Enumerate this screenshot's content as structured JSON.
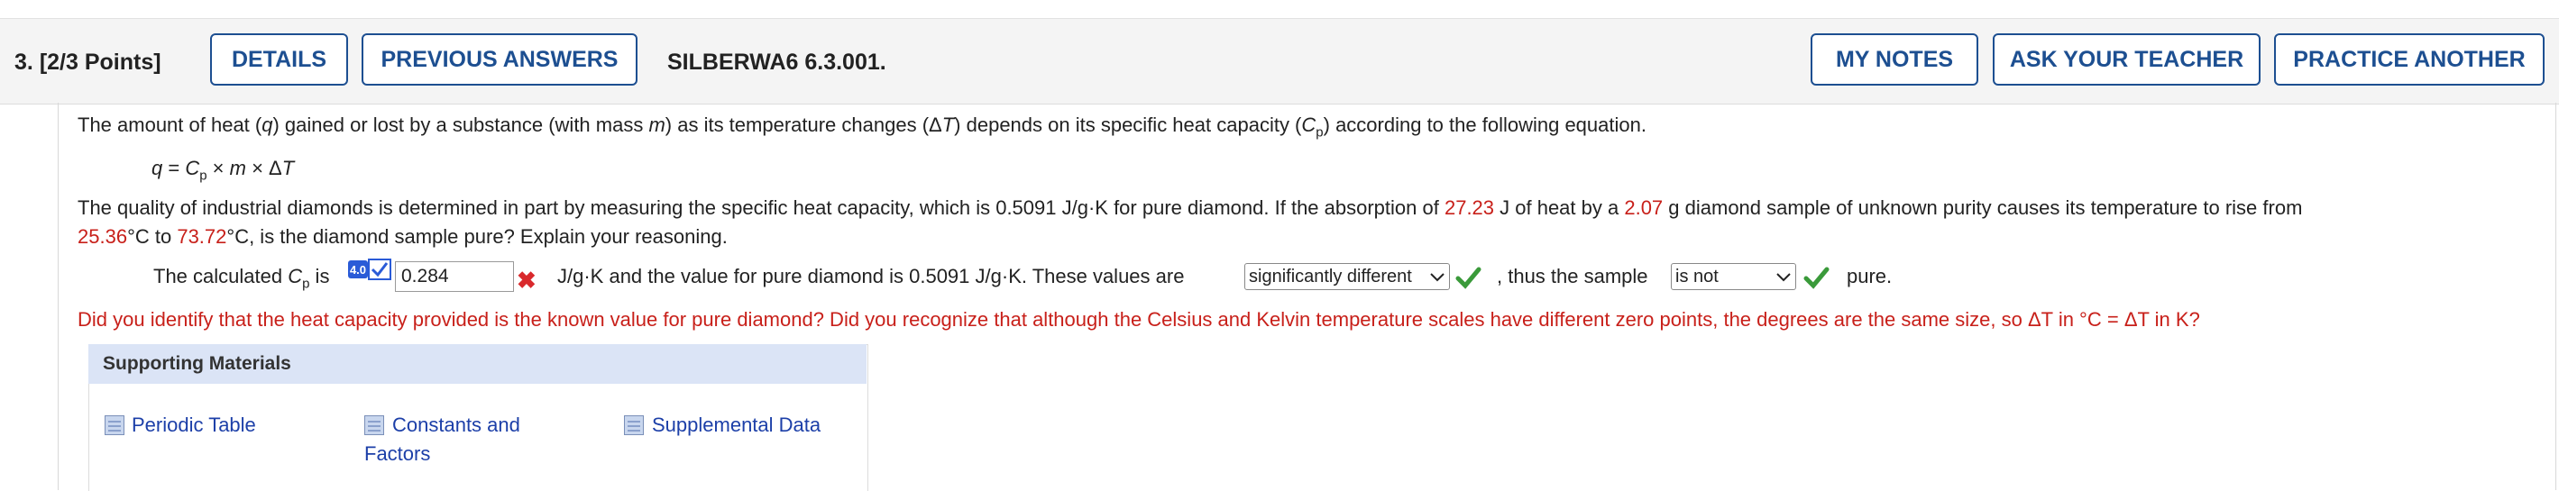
{
  "header": {
    "question_number": "3.",
    "points": "[2/3 Points]",
    "details_label": "DETAILS",
    "previous_answers_label": "PREVIOUS ANSWERS",
    "assignment_code": "SILBERWA6 6.3.001.",
    "my_notes_label": "MY NOTES",
    "ask_teacher_label": "ASK YOUR TEACHER",
    "practice_another_label": "PRACTICE ANOTHER"
  },
  "question": {
    "intro_a": "The amount of heat (",
    "q": "q",
    "intro_b": ") gained or lost by a substance (with mass ",
    "m": "m",
    "intro_c": ") as its temperature changes (Δ",
    "T": "T",
    "intro_d": ") depends on its specific heat capacity (",
    "C": "C",
    "p": "p",
    "intro_e": ") according to the following equation.",
    "eq_q": "q",
    "eq_eq": " = ",
    "eq_C": "C",
    "eq_p": "p",
    "eq_x1": " × ",
    "eq_m": "m",
    "eq_x2": " × Δ",
    "eq_T": "T",
    "body_a": "The quality of industrial diamonds is determined in part by measuring the specific heat capacity, which is 0.5091 J/g·K for pure diamond. If the absorption of ",
    "heat_value": "27.23",
    "body_b": " J of heat by a ",
    "mass_value": "2.07",
    "body_c": " g diamond sample of unknown purity causes its temperature to rise from",
    "temp_start": "25.36",
    "body_d": "°C to ",
    "temp_end": "73.72",
    "body_e": "°C, is the diamond sample pure? Explain your reasoning."
  },
  "answer": {
    "prefix": "The calculated ",
    "C": "C",
    "p": "p",
    "is": " is",
    "badge": "4.0",
    "value": "0.284",
    "mid": "J/g·K and the value for pure diamond is 0.5091 J/g·K. These values are",
    "select1": "significantly different",
    "mid2": ", thus the sample",
    "select2": "is not",
    "suffix": "pure."
  },
  "feedback": "Did you identify that the heat capacity provided is the known value for pure diamond? Did you recognize that although the Celsius and Kelvin temperature scales have different zero points, the degrees are the same size, so ΔT in °C = ΔT in K?",
  "supporting": {
    "title": "Supporting Materials",
    "links": [
      "Periodic Table",
      "Constants and",
      "Factors",
      "Supplemental Data"
    ]
  },
  "colors": {
    "accent": "#1d4f91",
    "error": "#c8201a",
    "correct": "#3a9a3a",
    "supp_header": "#dbe4f6"
  }
}
